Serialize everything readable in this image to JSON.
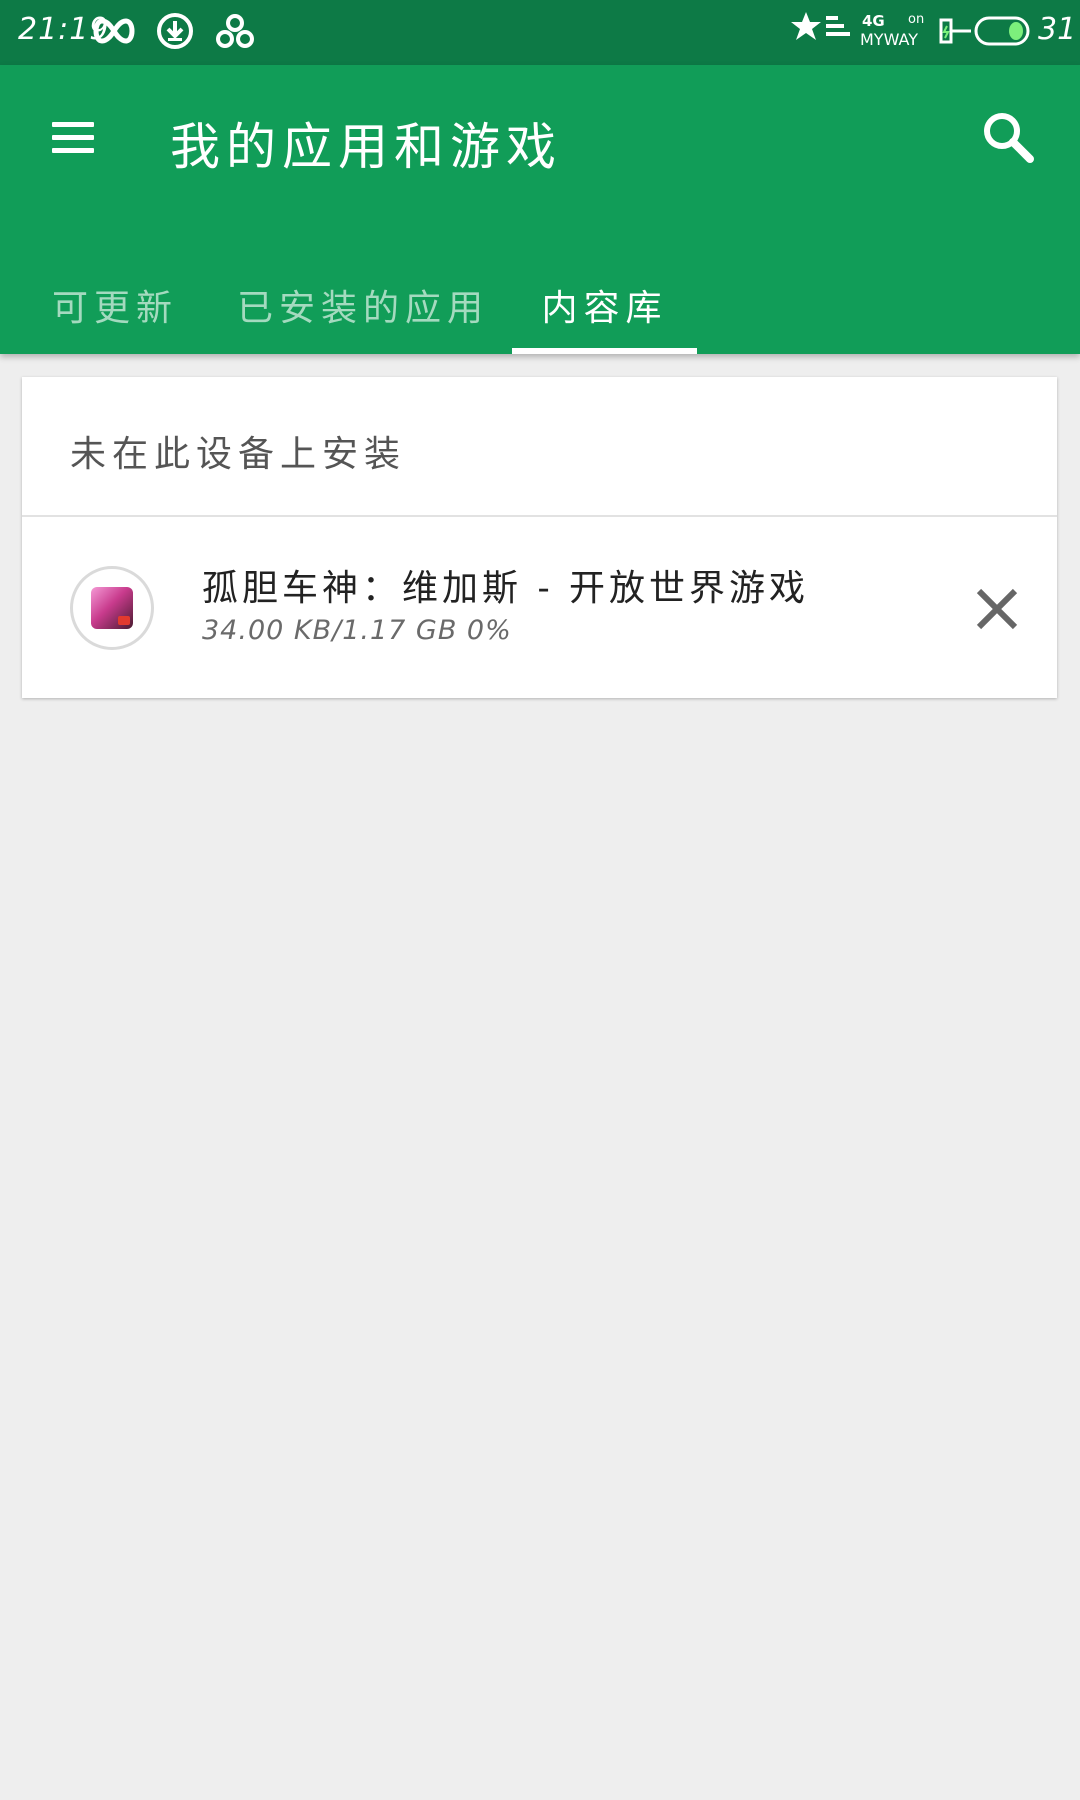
{
  "status_bar": {
    "time": "21:19",
    "network": "4G",
    "carrier": "MYWAY",
    "on_label": "on",
    "battery": "31",
    "icons": [
      "infinity-icon",
      "download-icon",
      "app-notification-icon",
      "star-signal-icon",
      "charging-icon",
      "battery-icon"
    ]
  },
  "app_bar": {
    "title": "我的应用和游戏",
    "menu_icon": "menu-icon",
    "search_icon": "search-icon",
    "color": "#119d58"
  },
  "tabs": [
    {
      "label": "可更新",
      "active": false
    },
    {
      "label": "已安装的应用",
      "active": false
    },
    {
      "label": "内容库",
      "active": true
    }
  ],
  "library": {
    "section_header": "未在此设备上安装",
    "items": [
      {
        "title": "孤胆车神：维加斯 - 开放世界游戏",
        "progress_text": "34.00 KB/1.17 GB  0%",
        "progress": 0,
        "close_icon": "close-icon"
      }
    ]
  }
}
